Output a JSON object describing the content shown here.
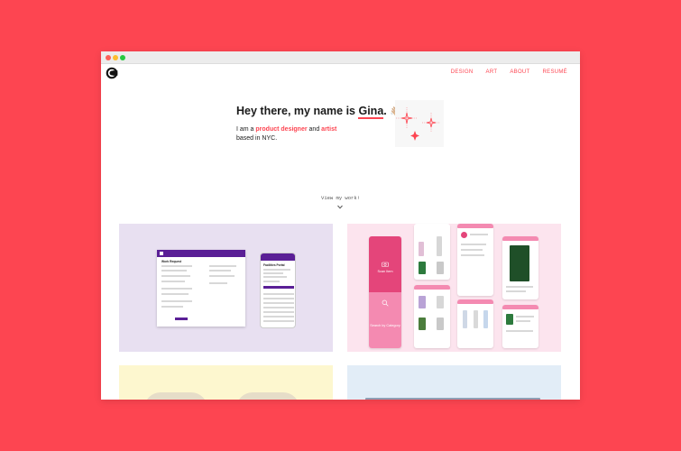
{
  "nav": [
    "DESIGN",
    "ART",
    "ABOUT",
    "RESUMÉ"
  ],
  "hero": {
    "greeting": "Hey there, my name is ",
    "name": "Gina",
    "period": ".",
    "hand_emoji": "👋🏼",
    "intro_a": "I am a ",
    "designer": "product designer",
    "and": " and ",
    "artist": "artist",
    "intro_b": "based in NYC."
  },
  "view_work": "View my work!",
  "project1": {
    "doc_title": "Work Request",
    "phone_title": "Facilities Portal"
  },
  "project2": {
    "scan_label": "Scan Item",
    "search_label": "Search by Category"
  },
  "colors": {
    "background": "#fd4551",
    "accent": "#fd4551",
    "purple": "#5a1f96",
    "pink": "#e4457a"
  },
  "icons": [
    "logo-icon",
    "sparkle-icon",
    "chevron-down-icon",
    "camera-icon",
    "search-icon"
  ]
}
